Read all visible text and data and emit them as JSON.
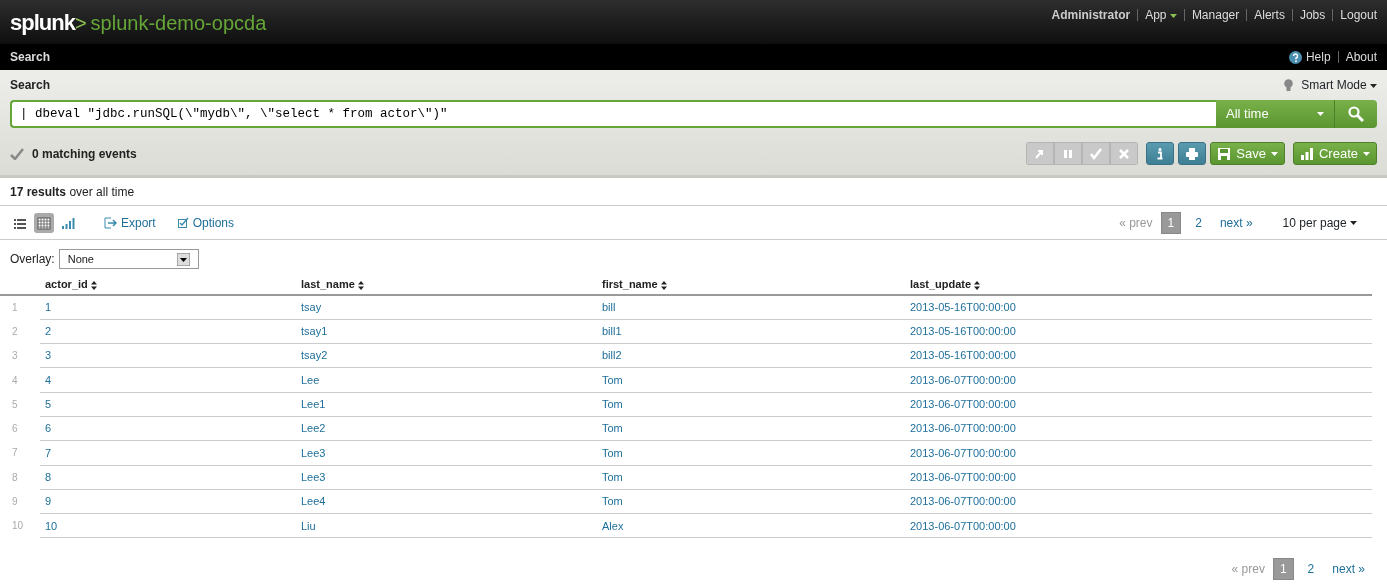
{
  "header": {
    "logo": "splunk",
    "logo_mark": ">",
    "app_name": "splunk-demo-opcda",
    "menu": [
      {
        "label": "Administrator",
        "kind": "user",
        "dropdown": false
      },
      {
        "label": "App",
        "kind": "link",
        "dropdown": true
      },
      {
        "label": "Manager",
        "kind": "link",
        "dropdown": false
      },
      {
        "label": "Alerts",
        "kind": "link",
        "dropdown": false
      },
      {
        "label": "Jobs",
        "kind": "link",
        "dropdown": false
      },
      {
        "label": "Logout",
        "kind": "link",
        "dropdown": false
      }
    ]
  },
  "nav": {
    "title": "Search",
    "help": "Help",
    "about": "About"
  },
  "search": {
    "label": "Search",
    "mode": "Smart Mode",
    "query": "| dbeval \"jdbc.runSQL(\\\"mydb\\\", \\\"select * from actor\\\")\"",
    "time_range": "All time"
  },
  "status": {
    "text": "0 matching events"
  },
  "job_controls": [
    {
      "kind": "send",
      "disabled": true
    },
    {
      "kind": "pause",
      "disabled": true
    },
    {
      "kind": "finalize",
      "disabled": true
    },
    {
      "kind": "cancel",
      "disabled": true
    },
    {
      "kind": "info",
      "disabled": false
    },
    {
      "kind": "print",
      "disabled": false
    },
    {
      "kind": "save",
      "label": "Save",
      "disabled": false
    },
    {
      "kind": "create",
      "label": "Create",
      "disabled": false
    }
  ],
  "results_summary": "**17 results** over all time",
  "toolbar": {
    "views": [
      {
        "kind": "list",
        "selected": false
      },
      {
        "kind": "table",
        "selected": true
      },
      {
        "kind": "chart",
        "selected": false
      }
    ],
    "export": "Export",
    "options": "Options"
  },
  "pagination": {
    "prev": "« prev",
    "pages": [
      {
        "label": "1",
        "selected": true
      },
      {
        "label": "2",
        "selected": false
      }
    ],
    "next": "next »",
    "per_page": "10 per page"
  },
  "overlay": {
    "label": "Overlay:",
    "value": "None"
  },
  "table": {
    "columns": [
      "actor_id",
      "last_name",
      "first_name",
      "last_update"
    ],
    "rows": [
      {
        "number": "1",
        "cells": [
          "1",
          "tsay",
          "bill",
          "2013-05-16T00:00:00"
        ]
      },
      {
        "number": "2",
        "cells": [
          "2",
          "tsay1",
          "bill1",
          "2013-05-16T00:00:00"
        ]
      },
      {
        "number": "3",
        "cells": [
          "3",
          "tsay2",
          "bill2",
          "2013-05-16T00:00:00"
        ]
      },
      {
        "number": "4",
        "cells": [
          "4",
          "Lee",
          "Tom",
          "2013-06-07T00:00:00"
        ]
      },
      {
        "number": "5",
        "cells": [
          "5",
          "Lee1",
          "Tom",
          "2013-06-07T00:00:00"
        ]
      },
      {
        "number": "6",
        "cells": [
          "6",
          "Lee2",
          "Tom",
          "2013-06-07T00:00:00"
        ]
      },
      {
        "number": "7",
        "cells": [
          "7",
          "Lee3",
          "Tom",
          "2013-06-07T00:00:00"
        ]
      },
      {
        "number": "8",
        "cells": [
          "8",
          "Lee3",
          "Tom",
          "2013-06-07T00:00:00"
        ]
      },
      {
        "number": "9",
        "cells": [
          "9",
          "Lee4",
          "Tom",
          "2013-06-07T00:00:00"
        ]
      },
      {
        "number": "10",
        "cells": [
          "10",
          "Liu",
          "Alex",
          "2013-06-07T00:00:00"
        ]
      }
    ]
  },
  "bottom_pagination": {
    "prev": "« prev",
    "pages": [
      {
        "label": "1",
        "selected": true
      },
      {
        "label": "2",
        "selected": false
      }
    ],
    "next": "next »"
  }
}
